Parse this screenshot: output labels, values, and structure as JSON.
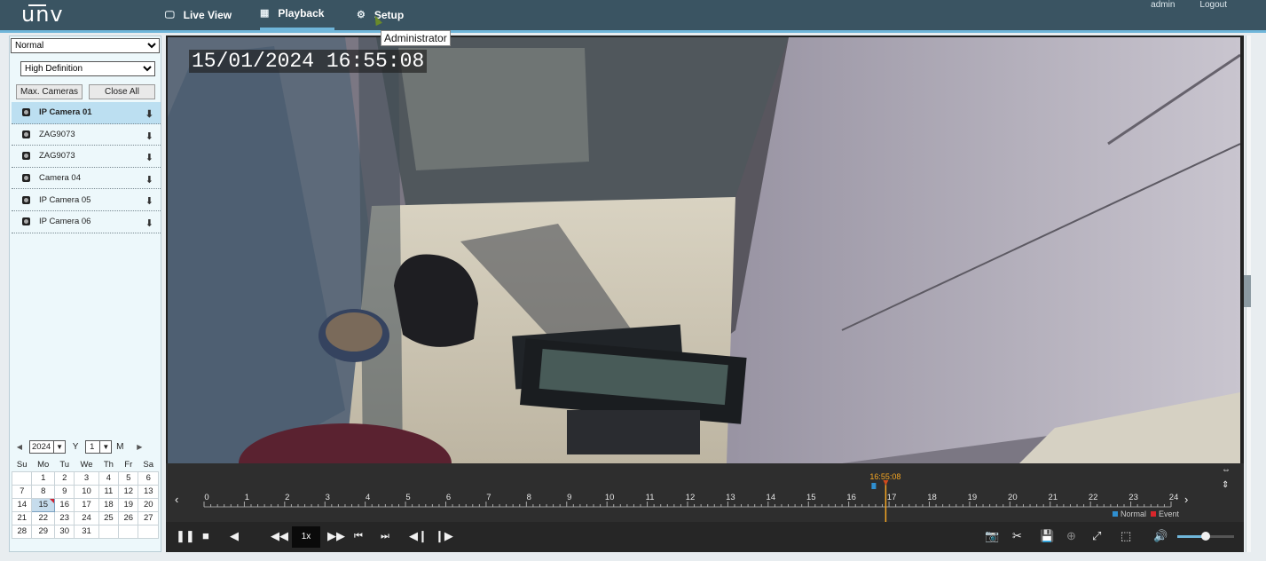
{
  "header": {
    "logo": "unv",
    "nav": [
      {
        "label": "Live View",
        "icon": "monitor-icon"
      },
      {
        "label": "Playback",
        "icon": "film-icon",
        "active": true
      },
      {
        "label": "Setup",
        "icon": "gear-icon"
      }
    ],
    "user": "admin",
    "logout": "Logout",
    "tooltip": "Administrator"
  },
  "sidebar": {
    "stream_select": "Normal",
    "quality_select": "High Definition",
    "max_cameras_label": "Max. Cameras",
    "close_all_label": "Close All",
    "cameras": [
      {
        "label": "IP Camera 01",
        "selected": true
      },
      {
        "label": "ZAG9073"
      },
      {
        "label": "ZAG9073"
      },
      {
        "label": "Camera 04"
      },
      {
        "label": "IP Camera 05"
      },
      {
        "label": "IP Camera 06"
      }
    ]
  },
  "calendar": {
    "year": "2024",
    "year_unit": "Y",
    "month": "1",
    "month_unit": "M",
    "weekdays": [
      "Su",
      "Mo",
      "Tu",
      "We",
      "Th",
      "Fr",
      "Sa"
    ],
    "weeks": [
      [
        "",
        "1",
        "2",
        "3",
        "4",
        "5",
        "6"
      ],
      [
        "7",
        "8",
        "9",
        "10",
        "11",
        "12",
        "13"
      ],
      [
        "14",
        "15",
        "16",
        "17",
        "18",
        "19",
        "20"
      ],
      [
        "21",
        "22",
        "23",
        "24",
        "25",
        "26",
        "27"
      ],
      [
        "28",
        "29",
        "30",
        "31",
        "",
        "",
        ""
      ]
    ],
    "selected_day": "15"
  },
  "player": {
    "osd_timestamp": "15/01/2024 16:55:08",
    "playhead_time": "16:55:08",
    "timeline_hours": [
      "0",
      "1",
      "2",
      "3",
      "4",
      "5",
      "6",
      "7",
      "8",
      "9",
      "10",
      "11",
      "12",
      "13",
      "14",
      "15",
      "16",
      "17",
      "18",
      "19",
      "20",
      "21",
      "22",
      "23",
      "24"
    ],
    "playhead_hour": 16.919,
    "speed": "1x",
    "legend": {
      "normal": "Normal",
      "event": "Event"
    },
    "colors": {
      "normal": "#2f8fd0",
      "event": "#d8262b",
      "playhead": "#f5a623",
      "accent": "#6fb6da"
    },
    "volume": 0.5
  }
}
